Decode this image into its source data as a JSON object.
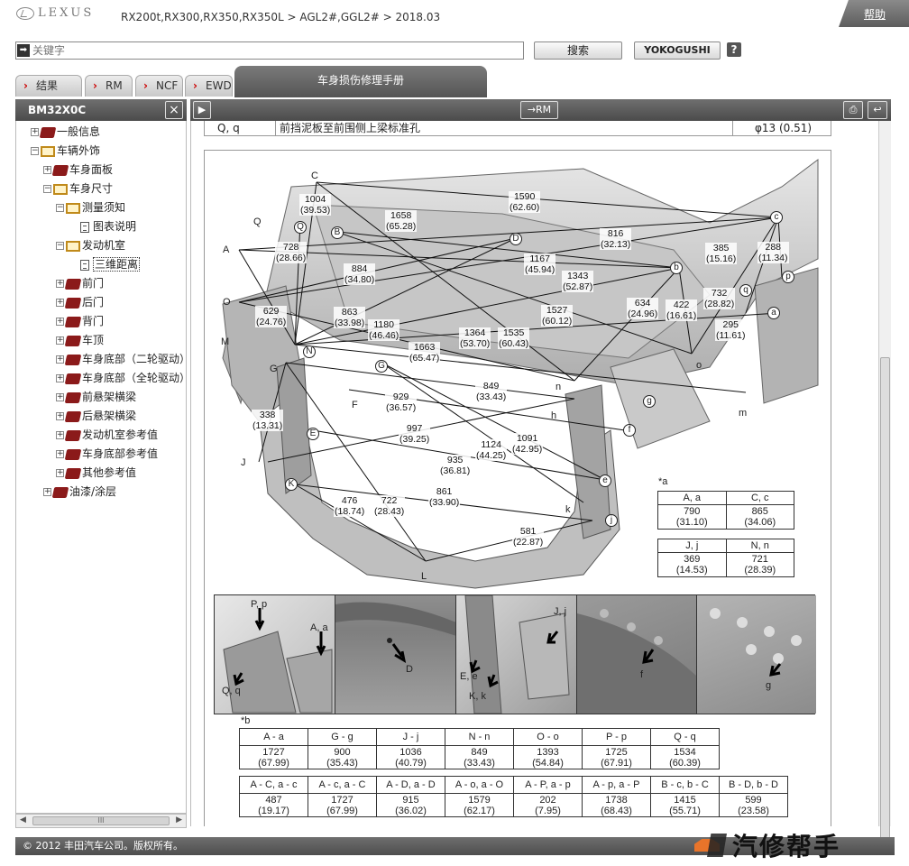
{
  "header": {
    "brand": "LEXUS",
    "breadcrumb": "RX200t,RX300,RX350,RX350L > AGL2#,GGL2# > 2018.03",
    "help": "帮助"
  },
  "search": {
    "placeholder": "关键字",
    "search_button": "搜索",
    "yokogushi_button": "YOKOGUSHI",
    "help_button": "?"
  },
  "tabs": [
    {
      "label": "结果"
    },
    {
      "label": "RM"
    },
    {
      "label": "NCF"
    },
    {
      "label": "EWD"
    }
  ],
  "active_tab": "车身损伤修理手册",
  "left_pane": {
    "code": "BM32X0C",
    "close": "×",
    "tree": [
      {
        "label": "一般信息",
        "level": 0,
        "toggle": "+",
        "icon": "book-closed"
      },
      {
        "label": "车辆外饰",
        "level": 0,
        "toggle": "−",
        "icon": "book-open"
      },
      {
        "label": "车身面板",
        "level": 1,
        "toggle": "+",
        "icon": "book-closed"
      },
      {
        "label": "车身尺寸",
        "level": 1,
        "toggle": "−",
        "icon": "book-open"
      },
      {
        "label": "测量须知",
        "level": 2,
        "toggle": "−",
        "icon": "book-open"
      },
      {
        "label": "图表说明",
        "level": 3,
        "toggle": "",
        "icon": "document"
      },
      {
        "label": "发动机室",
        "level": 2,
        "toggle": "−",
        "icon": "book-open"
      },
      {
        "label": "三维距离",
        "level": 3,
        "toggle": "",
        "icon": "document",
        "selected": true
      },
      {
        "label": "前门",
        "level": 2,
        "toggle": "+",
        "icon": "book-closed"
      },
      {
        "label": "后门",
        "level": 2,
        "toggle": "+",
        "icon": "book-closed"
      },
      {
        "label": "背门",
        "level": 2,
        "toggle": "+",
        "icon": "book-closed"
      },
      {
        "label": "车顶",
        "level": 2,
        "toggle": "+",
        "icon": "book-closed"
      },
      {
        "label": "车身底部（二轮驱动）",
        "level": 2,
        "toggle": "+",
        "icon": "book-closed"
      },
      {
        "label": "车身底部（全轮驱动）",
        "level": 2,
        "toggle": "+",
        "icon": "book-closed"
      },
      {
        "label": "前悬架横梁",
        "level": 2,
        "toggle": "+",
        "icon": "book-closed"
      },
      {
        "label": "后悬架横梁",
        "level": 2,
        "toggle": "+",
        "icon": "book-closed"
      },
      {
        "label": "发动机室参考值",
        "level": 2,
        "toggle": "+",
        "icon": "book-closed"
      },
      {
        "label": "车身底部参考值",
        "level": 2,
        "toggle": "+",
        "icon": "book-closed"
      },
      {
        "label": "其他参考值",
        "level": 2,
        "toggle": "+",
        "icon": "book-closed"
      },
      {
        "label": "油漆/涂层",
        "level": 1,
        "toggle": "+",
        "icon": "book-closed"
      }
    ]
  },
  "toolbar": {
    "play": "▶",
    "rm": "→RM",
    "print": "⎙",
    "back": "↩"
  },
  "top_row": {
    "point": "Q, q",
    "description": "前挡泥板至前围侧上梁标准孔",
    "value": "φ13 (0.51)"
  },
  "diagram": {
    "points_upper": [
      "A",
      "B",
      "C",
      "D",
      "E",
      "F",
      "G",
      "H",
      "J",
      "K",
      "L",
      "M",
      "N",
      "O",
      "P",
      "Q"
    ],
    "points_lower": [
      "a",
      "b",
      "c",
      "d",
      "e",
      "f",
      "g",
      "h",
      "j",
      "k",
      "m",
      "n",
      "o",
      "p",
      "q"
    ],
    "dimensions": [
      {
        "mm": "1590",
        "in": "(62.60)"
      },
      {
        "mm": "1004",
        "in": "(39.53)"
      },
      {
        "mm": "1658",
        "in": "(65.28)"
      },
      {
        "mm": "816",
        "in": "(32.13)"
      },
      {
        "mm": "728",
        "in": "(28.66)"
      },
      {
        "mm": "1167",
        "in": "(45.94)"
      },
      {
        "mm": "385",
        "in": "(15.16)"
      },
      {
        "mm": "288",
        "in": "(11.34)"
      },
      {
        "mm": "884",
        "in": "(34.80)"
      },
      {
        "mm": "1343",
        "in": "(52.87)"
      },
      {
        "mm": "732",
        "in": "(28.82)"
      },
      {
        "mm": "634",
        "in": "(24.96)"
      },
      {
        "mm": "422",
        "in": "(16.61)"
      },
      {
        "mm": "629",
        "in": "(24.76)"
      },
      {
        "mm": "863",
        "in": "(33.98)"
      },
      {
        "mm": "1527",
        "in": "(60.12)"
      },
      {
        "mm": "295",
        "in": "(11.61)"
      },
      {
        "mm": "1180",
        "in": "(46.46)"
      },
      {
        "mm": "1364",
        "in": "(53.70)"
      },
      {
        "mm": "1535",
        "in": "(60.43)"
      },
      {
        "mm": "1663",
        "in": "(65.47)"
      },
      {
        "mm": "849",
        "in": "(33.43)"
      },
      {
        "mm": "929",
        "in": "(36.57)"
      },
      {
        "mm": "338",
        "in": "(13.31)"
      },
      {
        "mm": "997",
        "in": "(39.25)"
      },
      {
        "mm": "1124",
        "in": "(44.25)"
      },
      {
        "mm": "1091",
        "in": "(42.95)"
      },
      {
        "mm": "935",
        "in": "(36.81)"
      },
      {
        "mm": "861",
        "in": "(33.90)"
      },
      {
        "mm": "476",
        "in": "(18.74)"
      },
      {
        "mm": "722",
        "in": "(28.43)"
      },
      {
        "mm": "581",
        "in": "(22.87)"
      }
    ],
    "note_a": "*a",
    "mini_table": [
      {
        "h1": "A, a",
        "h2": "C, c",
        "v1": "790",
        "i1": "(31.10)",
        "v2": "865",
        "i2": "(34.06)"
      },
      {
        "h1": "J, j",
        "h2": "N, n",
        "v1": "369",
        "i1": "(14.53)",
        "v2": "721",
        "i2": "(28.39)"
      }
    ],
    "photo_labels": [
      {
        "a": "P, p",
        "b": "A, a",
        "c": "Q, q"
      },
      {
        "a": "D"
      },
      {
        "a": "J, j",
        "b": "E, e",
        "c": "K, k"
      },
      {
        "a": "f"
      },
      {
        "a": "g"
      }
    ],
    "note_b": "*b",
    "table1": {
      "headers": [
        "A - a",
        "G - g",
        "J - j",
        "N - n",
        "O - o",
        "P - p",
        "Q - q"
      ],
      "mm": [
        "1727",
        "900",
        "1036",
        "849",
        "1393",
        "1725",
        "1534"
      ],
      "in": [
        "(67.99)",
        "(35.43)",
        "(40.79)",
        "(33.43)",
        "(54.84)",
        "(67.91)",
        "(60.39)"
      ]
    },
    "table2": {
      "headers": [
        "A - C, a - c",
        "A - c, a - C",
        "A - D, a - D",
        "A - o, a - O",
        "A - P, a - p",
        "A - p, a - P",
        "B - c, b - C",
        "B - D, b - D"
      ],
      "mm": [
        "487",
        "1727",
        "915",
        "1579",
        "202",
        "1738",
        "1415",
        "599"
      ],
      "in": [
        "(19.17)",
        "(67.99)",
        "(36.02)",
        "(62.17)",
        "(7.95)",
        "(68.43)",
        "(55.71)",
        "(23.58)"
      ]
    }
  },
  "footer": {
    "copyright": "© 2012 丰田汽车公司。版权所有。"
  },
  "watermark": "汽修帮手"
}
